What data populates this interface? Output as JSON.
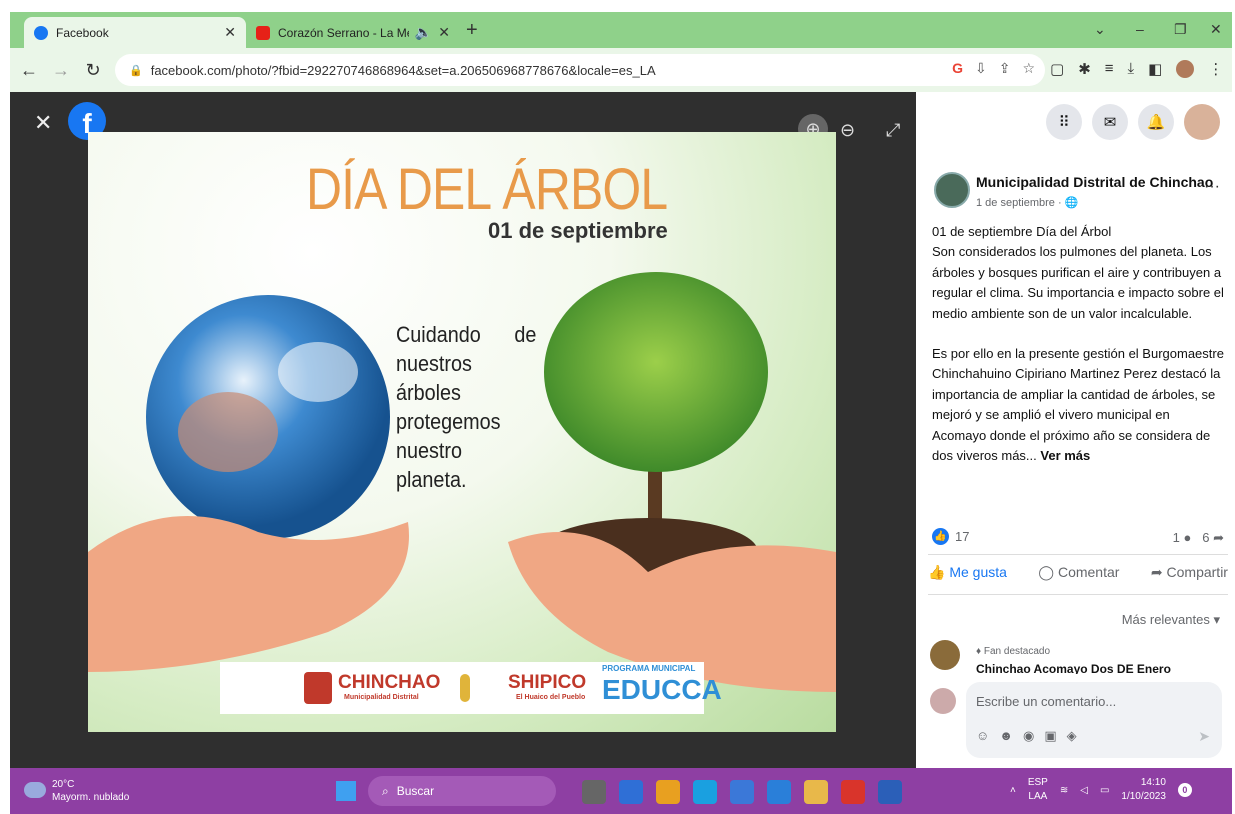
{
  "browser": {
    "tabs": [
      {
        "title": "Facebook",
        "favicon_color": "#1877f2"
      },
      {
        "title": "Corazón Serrano - La Mejo",
        "favicon_color": "#e62117"
      }
    ],
    "url": "facebook.com/photo/?fbid=292270746868964&set=a.206506968778676&locale=es_LA",
    "toolbar_icons": [
      "google-icon",
      "install-icon",
      "share-icon",
      "star-icon"
    ],
    "extension_icons": [
      "document-icon",
      "puzzle-icon",
      "queue-icon",
      "download-icon",
      "sidepanel-icon",
      "profile-avatar",
      "menu-icon"
    ]
  },
  "poster": {
    "title": "DÍA DEL ÁRBOL",
    "date": "01 de septiembre",
    "message": "Cuidando de nuestros árboles protegemos nuestro planeta.",
    "logos": [
      {
        "name": "CHINCHAO",
        "sub": "Municipalidad Distrital",
        "color": "#c0392b"
      },
      {
        "name": "SHIPICO",
        "sub": "El Huaico del Pueblo",
        "color": "#c0392b"
      },
      {
        "name": "EDUCCA",
        "sub": "PROGRAMA MUNICIPAL",
        "color": "#2f8fd6"
      }
    ],
    "colors": {
      "title": "#e89a4a",
      "background": "#d6ecc4"
    }
  },
  "post": {
    "page_name": "Municipalidad Distrital de Chinchao",
    "date": "1 de septiembre",
    "lines": [
      "01 de septiembre Día del Árbol",
      "Son considerados los pulmones del planeta. Los árboles y bosques purifican el aire y contribuyen a regular el clima. Su importancia e impacto sobre el medio ambiente son de un valor incalculable."
    ],
    "paragraph2": "Es por ello en la presente gestión el Burgomaestre Chinchahuino Cipiriano Martinez Perez destacó la importancia de ampliar la cantidad de árboles, se mejoró y se amplió el vivero municipal en Acomayo donde el próximo año se considera de dos viveros más...",
    "see_more": "Ver más",
    "reaction_count": "17",
    "comment_count": "1",
    "share_count": "6",
    "actions": {
      "like": "Me gusta",
      "comment": "Comentar",
      "share": "Compartir"
    },
    "sort_label": "Más relevantes",
    "fan_badge": "Fan destacado",
    "top_comment_author": "Chinchao Acomayo Dos DE Enero",
    "comment_placeholder": "Escribe un comentario..."
  },
  "taskbar": {
    "temperature": "20°C",
    "weather": "Mayorm. nublado",
    "search": "Buscar",
    "lang": "ESP",
    "layout": "LAA",
    "time": "14:10",
    "date": "1/10/2023",
    "notifications": "0",
    "app_colors": [
      "#666666",
      "#2f6fd6",
      "#e8a020",
      "#1aa0e0",
      "#3b78d8",
      "#2a7fd9",
      "#e8b84a",
      "#d9342b",
      "#2b5fb8"
    ]
  }
}
